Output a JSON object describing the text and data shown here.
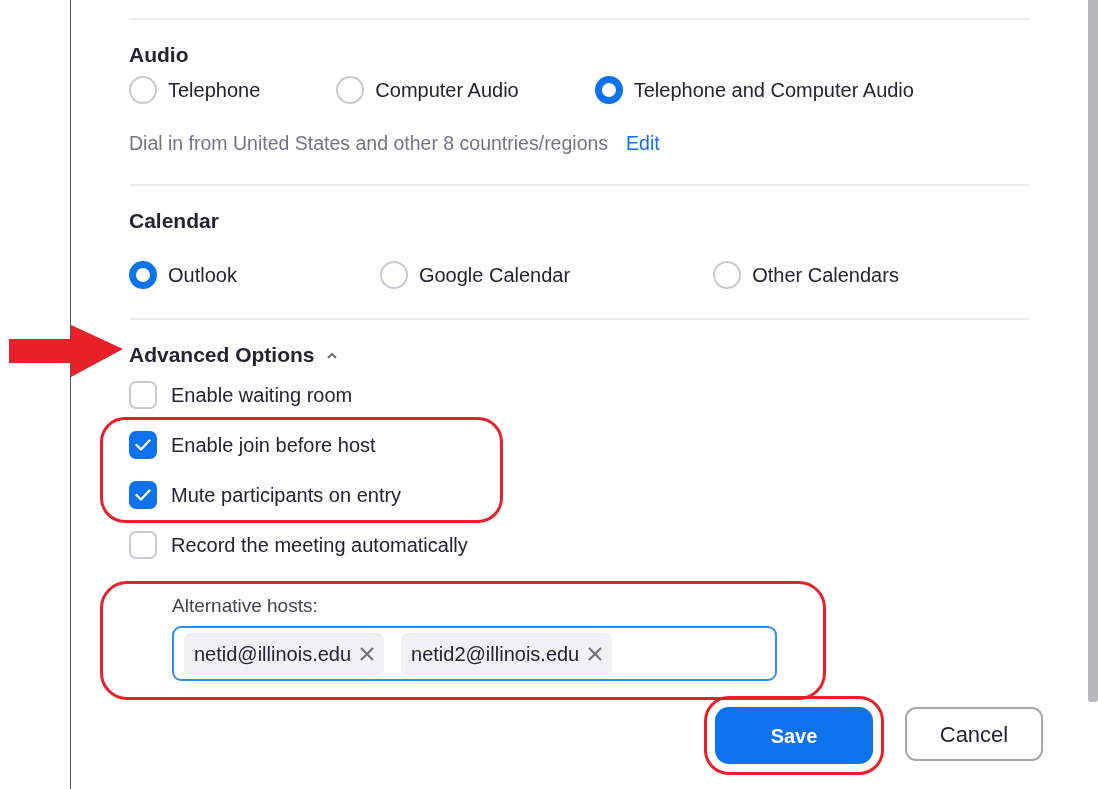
{
  "sections": [
    {
      "title": "Audio",
      "options": [
        {
          "label": "Telephone",
          "selected": false
        },
        {
          "label": "Computer Audio",
          "selected": false
        },
        {
          "label": "Telephone and Computer Audio",
          "selected": true
        }
      ],
      "note": "Dial in from United States and other 8 countries/regions",
      "note_link": "Edit"
    },
    {
      "title": "Calendar",
      "options": [
        {
          "label": "Outlook",
          "selected": true
        },
        {
          "label": "Google Calendar",
          "selected": false
        },
        {
          "label": "Other Calendars",
          "selected": false
        }
      ]
    }
  ],
  "advanced": {
    "title": "Advanced Options",
    "expanded": true,
    "pointed_at": true,
    "items": [
      {
        "kind": "checkbox",
        "label": "Enable waiting room",
        "checked": false,
        "highlighted": false
      },
      {
        "kind": "checkbox",
        "label": "Enable join before host",
        "checked": true,
        "highlighted": true
      },
      {
        "kind": "checkbox",
        "label": "Mute participants on entry",
        "checked": true,
        "highlighted": true
      },
      {
        "kind": "checkbox",
        "label": "Record the meeting automatically",
        "checked": false,
        "highlighted": false
      },
      {
        "kind": "hosts",
        "label": "Alternative hosts:",
        "chips": [
          "netid@illinois.edu",
          "netid2@illinois.edu"
        ],
        "highlighted": true
      }
    ]
  },
  "buttons": [
    {
      "label": "Save",
      "kind": "primary",
      "highlighted": true
    },
    {
      "label": "Cancel",
      "kind": "secondary",
      "highlighted": false
    }
  ]
}
